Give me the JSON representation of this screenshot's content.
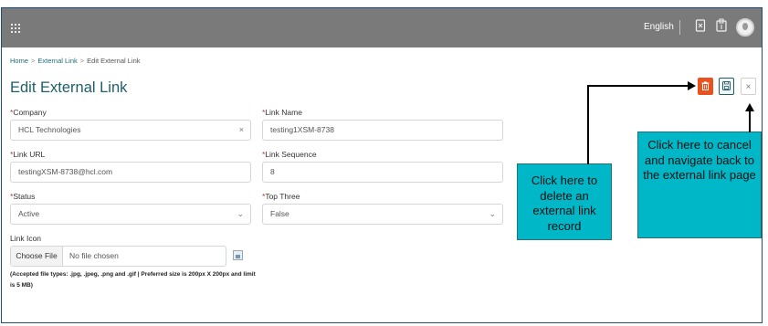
{
  "topbar": {
    "apps_icon": "apps-grid-icon",
    "language": "English",
    "icons": [
      "bookmark-icon",
      "clipboard-icon"
    ],
    "avatar_icon": "user-avatar-icon"
  },
  "breadcrumb": {
    "home": "Home",
    "external_link": "External Link",
    "current": "Edit External Link",
    "separator": ">"
  },
  "page": {
    "title": "Edit External Link"
  },
  "form": {
    "required_mark": "*",
    "company": {
      "label": "Company",
      "value": "HCL Technologies",
      "clear": "×"
    },
    "link_name": {
      "label": "Link Name",
      "value": "testing1XSM-8738"
    },
    "link_url": {
      "label": "Link URL",
      "value": "testingXSM-8738@hcl.com"
    },
    "link_sequence": {
      "label": "Link Sequence",
      "value": "8"
    },
    "status": {
      "label": "Status",
      "value": "Active",
      "chevron": "⌄"
    },
    "top_three": {
      "label": "Top Three",
      "value": "False",
      "chevron": "⌄"
    },
    "link_icon": {
      "label": "Link Icon",
      "button": "Choose File",
      "file_status": "No file chosen",
      "hint": "(Accepted file types: .jpg, .jpeg, .png and .gif | Preferred size is 200px X 200px and limit is 5 MB)"
    }
  },
  "actions": {
    "delete_icon": "trash-icon",
    "save_icon": "save-icon",
    "cancel_label": "×"
  },
  "callouts": {
    "delete": "Click here to delete an external link record",
    "cancel": "Click here to cancel and navigate back to the external link page"
  },
  "colors": {
    "topbar": "#7a7a7a",
    "title": "#1d5e6b",
    "delete_button": "#e8521f",
    "callout": "#00b7c7",
    "required": "#c0392b"
  }
}
